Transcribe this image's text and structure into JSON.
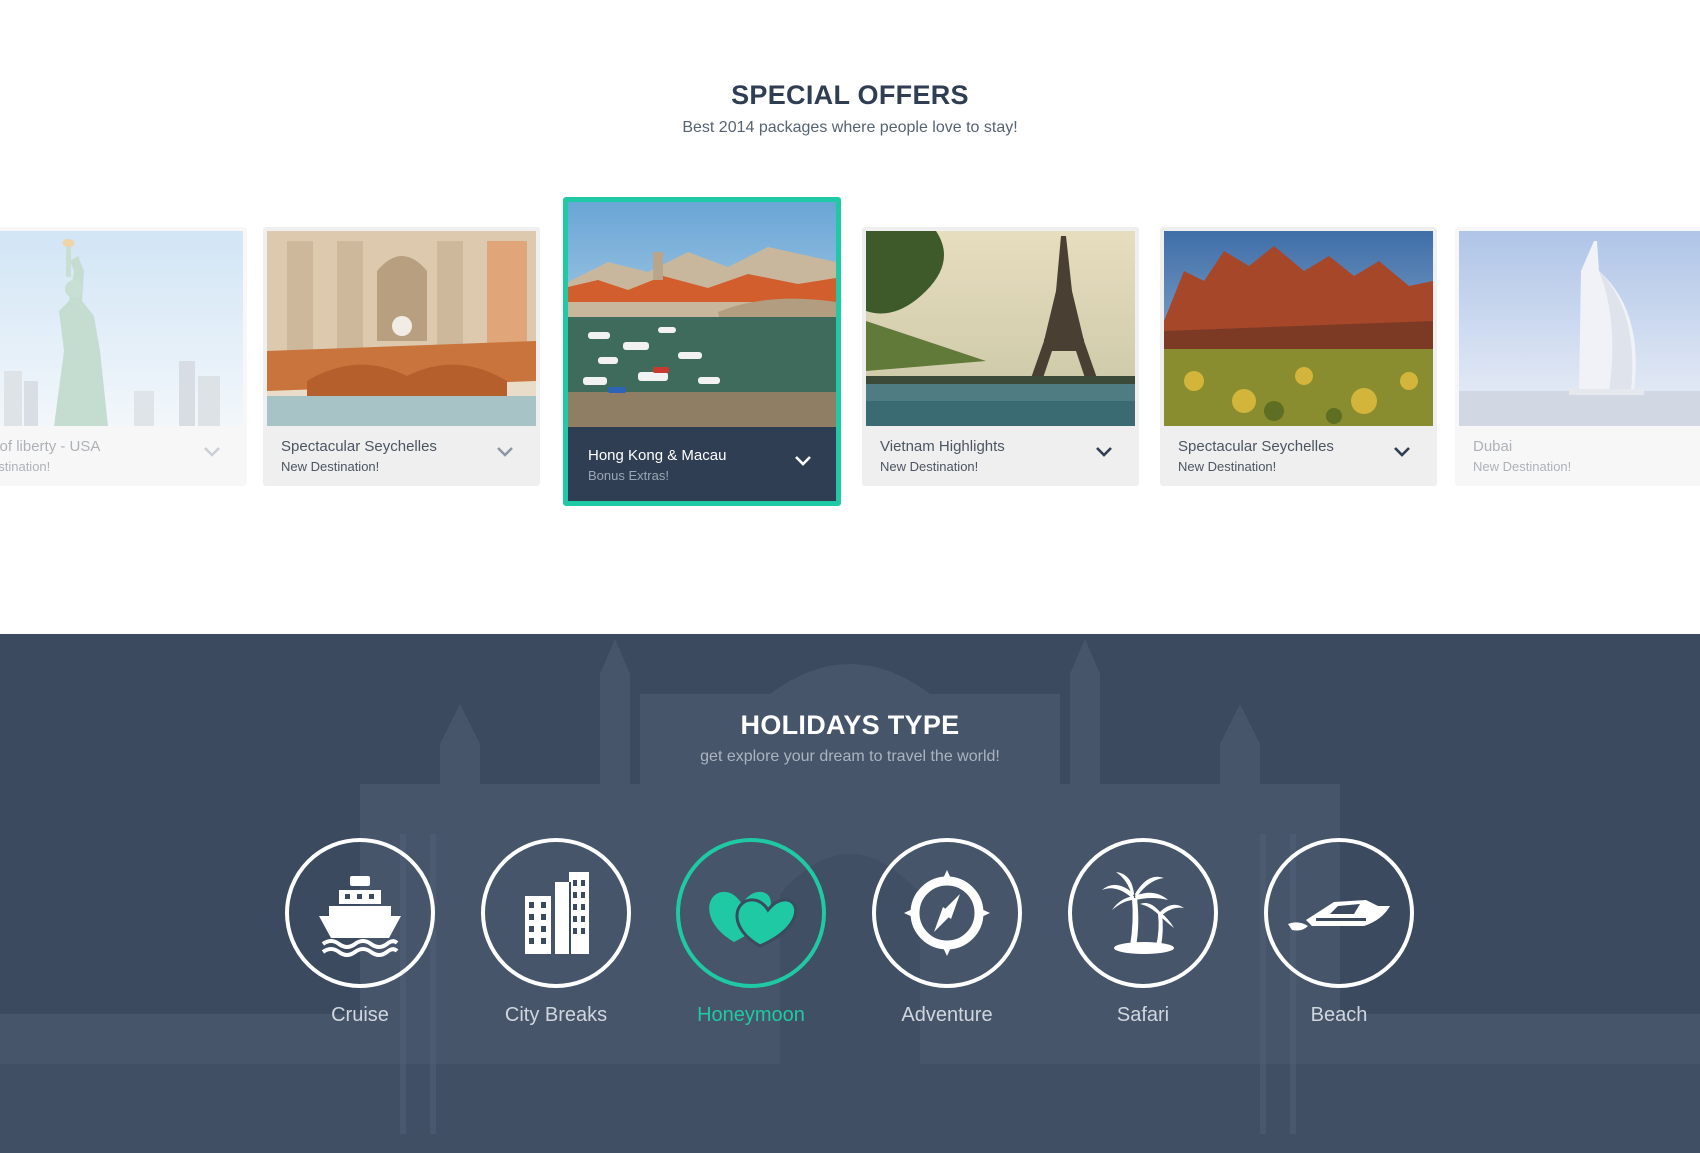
{
  "special_offers": {
    "title": "SPECIAL OFFERS",
    "subtitle": "Best 2014 packages where people love to stay!",
    "cards": [
      {
        "name": "Statue of liberty - USA",
        "tag": "New Destination!",
        "state": "faded"
      },
      {
        "name": "Spectacular Seychelles",
        "tag": "New Destination!",
        "state": "normal"
      },
      {
        "name": "Hong Kong & Macau",
        "tag": "Bonus Extras!",
        "state": "active"
      },
      {
        "name": "Vietnam Highlights",
        "tag": "New Destination!",
        "state": "normal"
      },
      {
        "name": "Spectacular Seychelles",
        "tag": "New Destination!",
        "state": "normal"
      },
      {
        "name": "Dubai",
        "tag": "New Destination!",
        "state": "faded"
      }
    ]
  },
  "holidays_type": {
    "title": "HOLIDAYS TYPE",
    "subtitle": "get explore your dream to travel the world!",
    "types": [
      {
        "label": "Cruise",
        "icon": "cruise-ship-icon"
      },
      {
        "label": "City Breaks",
        "icon": "buildings-icon"
      },
      {
        "label": "Honeymoon",
        "icon": "hearts-icon",
        "active": true
      },
      {
        "label": "Adventure",
        "icon": "compass-icon"
      },
      {
        "label": "Safari",
        "icon": "palm-trees-icon"
      },
      {
        "label": "Beach",
        "icon": "speedboat-icon"
      }
    ]
  },
  "colors": {
    "accent": "#1fc9a4",
    "navy": "#2f3e52",
    "section_bg": "#3b4a5f",
    "card_bg": "#efefef"
  }
}
